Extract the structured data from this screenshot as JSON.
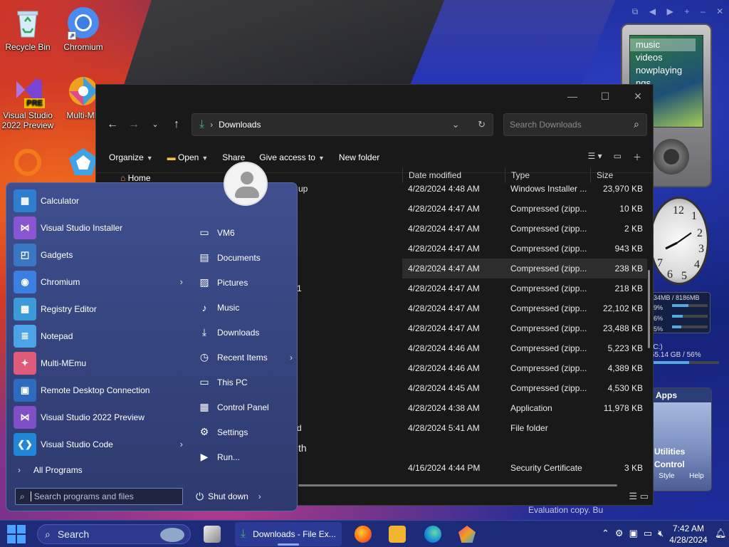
{
  "desktop": {
    "icons": [
      {
        "label": "Recycle Bin"
      },
      {
        "label": "Chromium"
      },
      {
        "label": "Visual Studio 2022 Preview",
        "badge": "PRE"
      },
      {
        "label": "Multi-ME"
      }
    ]
  },
  "gadgets": {
    "zune_menu": [
      "music",
      "videos",
      "nowplaying",
      "ngs"
    ],
    "clock_numbers": [
      "12",
      "1",
      "2",
      "3",
      "4",
      "5",
      "6",
      "7"
    ],
    "meter": {
      "header": "34MB / 8186MB",
      "rows": [
        {
          "label": "9%",
          "level": 0.09
        },
        {
          "label": "6%",
          "level": 0.06
        },
        {
          "label": "5%",
          "level": 0.05
        }
      ]
    },
    "drive": {
      "label": "(C:)",
      "detail": "55.14 GB / 56%",
      "level": 0.56
    },
    "apps": {
      "title": "Apps",
      "items": [
        "Utilities",
        "Control"
      ],
      "footer": [
        "Style",
        "Help"
      ]
    }
  },
  "watermark": "Evaluation copy. Bu",
  "explorer": {
    "address": "Downloads",
    "search_placeholder": "Search Downloads",
    "commands": {
      "organize": "Organize",
      "open": "Open",
      "share": "Share",
      "give_access": "Give access to",
      "new_folder": "New folder"
    },
    "nav_home": "Home",
    "columns": {
      "date": "Date modified",
      "type": "Type",
      "size": "Size"
    },
    "name_fragments": [
      "up",
      "1",
      "d",
      "th"
    ],
    "rows": [
      {
        "date": "4/28/2024 4:48 AM",
        "type": "Windows Installer ...",
        "size": "23,970 KB"
      },
      {
        "date": "4/28/2024 4:47 AM",
        "type": "Compressed (zipp...",
        "size": "10 KB"
      },
      {
        "date": "4/28/2024 4:47 AM",
        "type": "Compressed (zipp...",
        "size": "2 KB"
      },
      {
        "date": "4/28/2024 4:47 AM",
        "type": "Compressed (zipp...",
        "size": "943 KB"
      },
      {
        "date": "4/28/2024 4:47 AM",
        "type": "Compressed (zipp...",
        "size": "238 KB"
      },
      {
        "date": "4/28/2024 4:47 AM",
        "type": "Compressed (zipp...",
        "size": "218 KB"
      },
      {
        "date": "4/28/2024 4:47 AM",
        "type": "Compressed (zipp...",
        "size": "22,102 KB"
      },
      {
        "date": "4/28/2024 4:47 AM",
        "type": "Compressed (zipp...",
        "size": "23,488 KB"
      },
      {
        "date": "4/28/2024 4:46 AM",
        "type": "Compressed (zipp...",
        "size": "5,223 KB"
      },
      {
        "date": "4/28/2024 4:46 AM",
        "type": "Compressed (zipp...",
        "size": "4,389 KB"
      },
      {
        "date": "4/28/2024 4:45 AM",
        "type": "Compressed (zipp...",
        "size": "4,530 KB"
      },
      {
        "date": "4/28/2024 4:38 AM",
        "type": "Application",
        "size": "11,978 KB"
      },
      {
        "date": "4/28/2024 5:41 AM",
        "type": "File folder",
        "size": ""
      },
      {
        "date": "",
        "type": "",
        "size": ""
      },
      {
        "date": "4/16/2024 4:44 PM",
        "type": "Security Certificate",
        "size": "3 KB"
      }
    ]
  },
  "start_menu": {
    "pinned": [
      {
        "label": "Calculator",
        "icon": "calculator-icon",
        "color": "#2f7fcf"
      },
      {
        "label": "Visual Studio Installer",
        "icon": "vs-installer-icon",
        "color": "#8a55d0"
      },
      {
        "label": "Gadgets",
        "icon": "gadgets-icon",
        "color": "#3a77c2"
      },
      {
        "label": "Chromium",
        "icon": "chromium-icon",
        "color": "#3b7fe0",
        "submenu": true
      },
      {
        "label": "Registry Editor",
        "icon": "registry-editor-icon",
        "color": "#3b9ad8"
      },
      {
        "label": "Notepad",
        "icon": "notepad-icon",
        "color": "#4aa3e6"
      },
      {
        "label": "Multi-MEmu",
        "icon": "multi-memu-icon",
        "color": "#e05a7a"
      },
      {
        "label": "Remote Desktop Connection",
        "icon": "remote-desktop-icon",
        "color": "#2e6bbf"
      },
      {
        "label": "Visual Studio 2022 Preview",
        "icon": "vs-preview-icon",
        "color": "#7f4fc8"
      },
      {
        "label": "Visual Studio Code",
        "icon": "vscode-icon",
        "color": "#1f86d8",
        "submenu": true
      }
    ],
    "all_programs": "All Programs",
    "links": [
      {
        "label": "VM6",
        "icon": "folder-icon"
      },
      {
        "label": "Documents",
        "icon": "documents-icon"
      },
      {
        "label": "Pictures",
        "icon": "pictures-icon"
      },
      {
        "label": "Music",
        "icon": "music-icon"
      },
      {
        "label": "Downloads",
        "icon": "downloads-icon"
      },
      {
        "label": "Recent Items",
        "icon": "recent-items-icon",
        "submenu": true
      },
      {
        "label": "This PC",
        "icon": "this-pc-icon"
      },
      {
        "label": "Control Panel",
        "icon": "control-panel-icon"
      },
      {
        "label": "Settings",
        "icon": "settings-icon"
      },
      {
        "label": "Run...",
        "icon": "run-icon"
      }
    ],
    "search_placeholder": "Search programs and files",
    "shutdown": "Shut down"
  },
  "taskbar": {
    "search_label": "Search",
    "explorer_button": "Downloads - File Ex...",
    "time": "7:42 AM",
    "date": "4/28/2024"
  }
}
